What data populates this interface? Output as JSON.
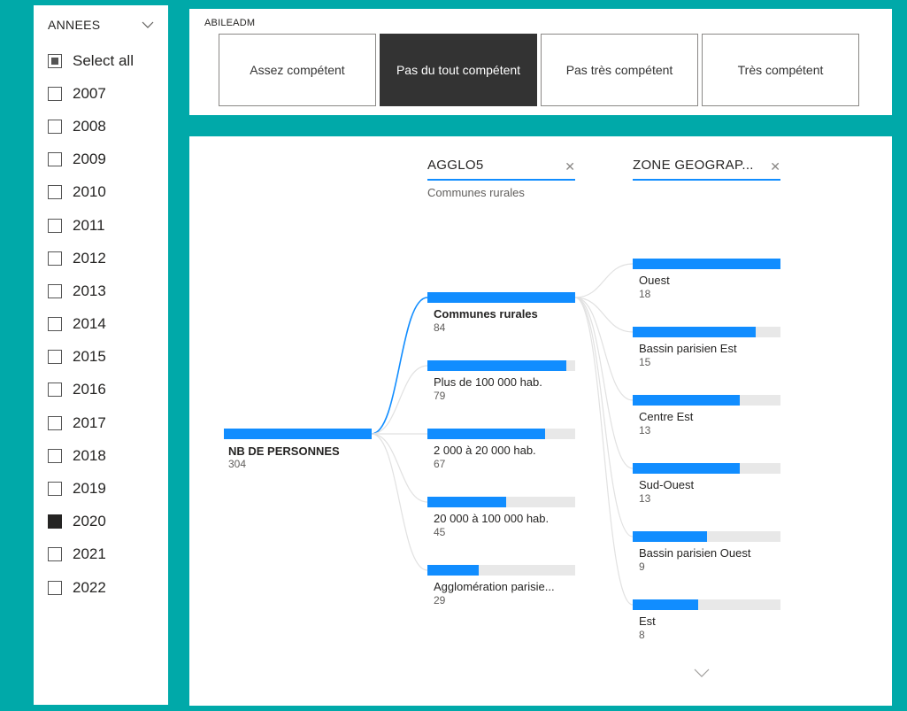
{
  "slicer": {
    "title": "ANNEES",
    "items": [
      {
        "label": "Select all",
        "state": "partial"
      },
      {
        "label": "2007",
        "state": "unchecked"
      },
      {
        "label": "2008",
        "state": "unchecked"
      },
      {
        "label": "2009",
        "state": "unchecked"
      },
      {
        "label": "2010",
        "state": "unchecked"
      },
      {
        "label": "2011",
        "state": "unchecked"
      },
      {
        "label": "2012",
        "state": "unchecked"
      },
      {
        "label": "2013",
        "state": "unchecked"
      },
      {
        "label": "2014",
        "state": "unchecked"
      },
      {
        "label": "2015",
        "state": "unchecked"
      },
      {
        "label": "2016",
        "state": "unchecked"
      },
      {
        "label": "2017",
        "state": "unchecked"
      },
      {
        "label": "2018",
        "state": "unchecked"
      },
      {
        "label": "2019",
        "state": "unchecked"
      },
      {
        "label": "2020",
        "state": "checked"
      },
      {
        "label": "2021",
        "state": "unchecked"
      },
      {
        "label": "2022",
        "state": "unchecked"
      }
    ]
  },
  "filter": {
    "title": "ABILEADM",
    "buttons": [
      {
        "label": "Assez compétent",
        "selected": false
      },
      {
        "label": "Pas du tout compétent",
        "selected": true
      },
      {
        "label": "Pas très compétent",
        "selected": false
      },
      {
        "label": "Très compétent",
        "selected": false
      }
    ]
  },
  "tree": {
    "root": {
      "label": "NB DE PERSONNES",
      "value": "304"
    },
    "levels": [
      {
        "title": "AGGLO5",
        "subtitle": "Communes rurales"
      },
      {
        "title": "ZONE GEOGRAP...",
        "subtitle": ""
      }
    ],
    "level1": [
      {
        "label": "Communes rurales",
        "value": "84",
        "selected": true
      },
      {
        "label": "Plus de 100 000 hab.",
        "value": "79",
        "selected": false
      },
      {
        "label": "2 000 à 20 000 hab.",
        "value": "67",
        "selected": false
      },
      {
        "label": "20 000 à 100 000 hab.",
        "value": "45",
        "selected": false
      },
      {
        "label": "Agglomération parisie...",
        "value": "29",
        "selected": false
      }
    ],
    "level2": [
      {
        "label": "Ouest",
        "value": "18"
      },
      {
        "label": "Bassin parisien Est",
        "value": "15"
      },
      {
        "label": "Centre Est",
        "value": "13"
      },
      {
        "label": "Sud-Ouest",
        "value": "13"
      },
      {
        "label": "Bassin parisien Ouest",
        "value": "9"
      },
      {
        "label": "Est",
        "value": "8"
      }
    ],
    "colors": {
      "bar": "#118dff",
      "track": "#e8e8e8",
      "selected_link": "#118dff",
      "link": "#e1e1e1"
    }
  }
}
